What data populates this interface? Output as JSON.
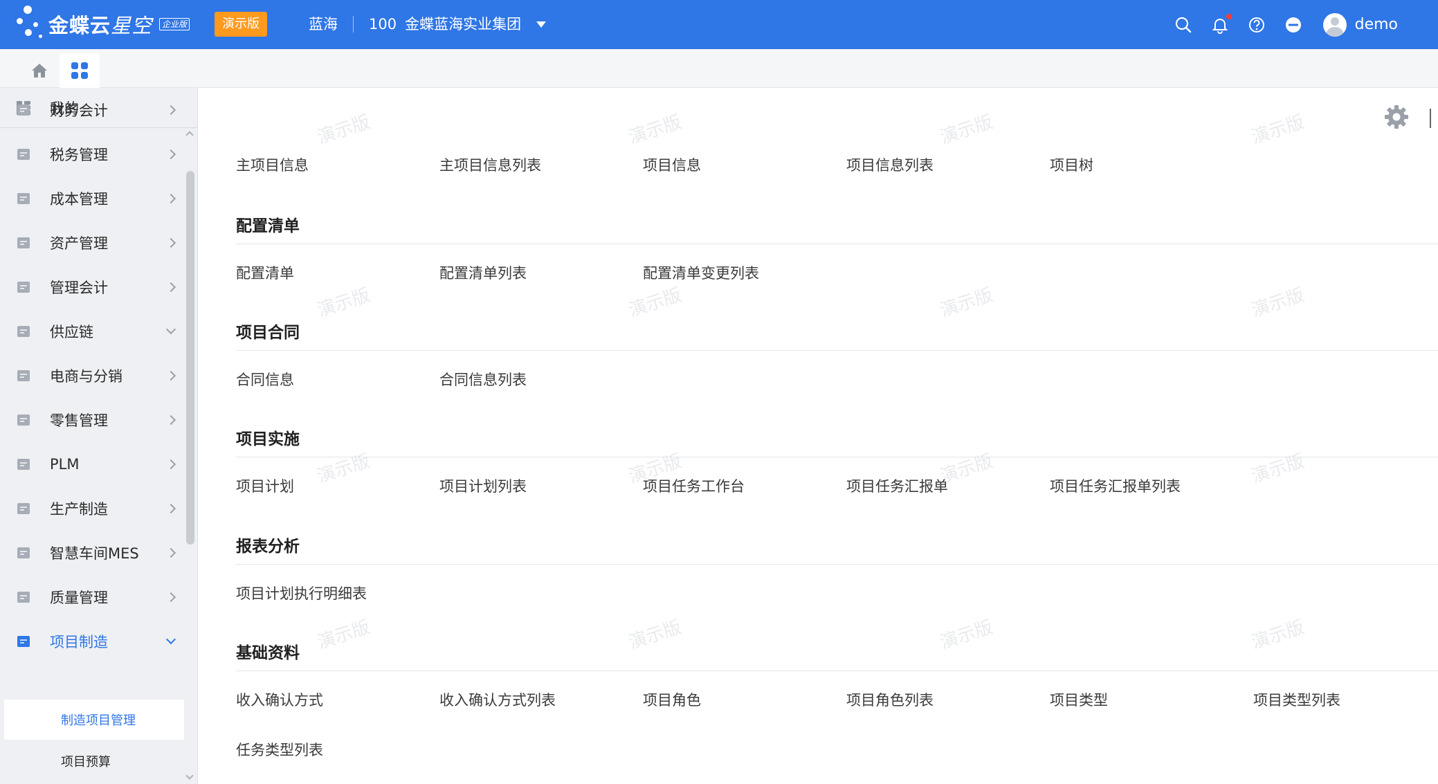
{
  "header": {
    "logo_text": "金蝶云",
    "logo_text_2": "星空",
    "edition": "企业版",
    "demo_badge": "演示版",
    "org_name": "蓝海",
    "org_code": "100",
    "org_group": "金蝶蓝海实业集团",
    "username": "demo",
    "accent_color": "#2f76e6"
  },
  "sidebar": {
    "mine": "我的",
    "items": [
      {
        "label": "财务会计",
        "icon": "finance-icon",
        "expanded": false
      },
      {
        "label": "税务管理",
        "icon": "tax-icon",
        "expanded": false
      },
      {
        "label": "成本管理",
        "icon": "cost-icon",
        "expanded": false
      },
      {
        "label": "资产管理",
        "icon": "asset-icon",
        "expanded": false
      },
      {
        "label": "管理会计",
        "icon": "management-accounting-icon",
        "expanded": false
      },
      {
        "label": "供应链",
        "icon": "supply-chain-icon",
        "expanded": true
      },
      {
        "label": "电商与分销",
        "icon": "ecommerce-icon",
        "expanded": false
      },
      {
        "label": "零售管理",
        "icon": "retail-icon",
        "expanded": false
      },
      {
        "label": "PLM",
        "icon": "plm-icon",
        "expanded": false
      },
      {
        "label": "生产制造",
        "icon": "manufacturing-icon",
        "expanded": false
      },
      {
        "label": "智慧车间MES",
        "icon": "mes-icon",
        "expanded": false
      },
      {
        "label": "质量管理",
        "icon": "quality-icon",
        "expanded": false
      },
      {
        "label": "项目制造",
        "icon": "project-manufacturing-icon",
        "expanded": true
      }
    ],
    "sub_items": [
      "制造项目管理",
      "项目预算"
    ]
  },
  "main": {
    "sections": [
      {
        "title": "",
        "links": [
          "主项目信息",
          "主项目信息列表",
          "项目信息",
          "项目信息列表",
          "项目树"
        ]
      },
      {
        "title": "配置清单",
        "links": [
          "配置清单",
          "配置清单列表",
          "配置清单变更列表"
        ]
      },
      {
        "title": "项目合同",
        "links": [
          "合同信息",
          "合同信息列表"
        ]
      },
      {
        "title": "项目实施",
        "links": [
          "项目计划",
          "项目计划列表",
          "项目任务工作台",
          "项目任务汇报单",
          "项目任务汇报单列表"
        ]
      },
      {
        "title": "报表分析",
        "links": [
          "项目计划执行明细表"
        ]
      },
      {
        "title": "基础资料",
        "links": [
          "收入确认方式",
          "收入确认方式列表",
          "项目角色",
          "项目角色列表",
          "项目类型",
          "项目类型列表",
          "任务类型列表"
        ]
      }
    ]
  },
  "watermark": "演示版"
}
